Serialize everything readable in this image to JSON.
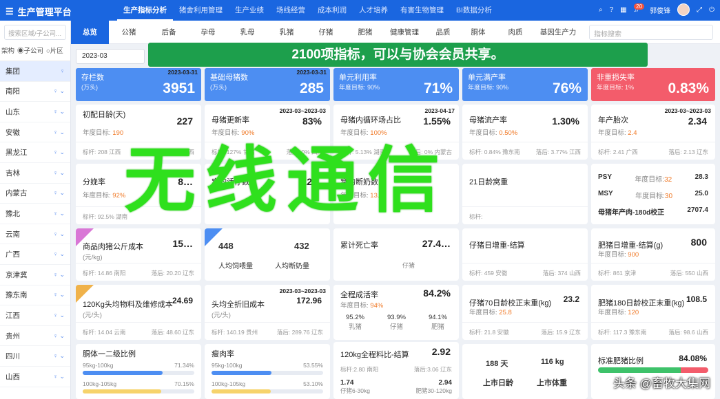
{
  "app": {
    "title": "生产管理平台",
    "icon": "stack-icon"
  },
  "nav": [
    "生产指标分析",
    "猪舍利用管理",
    "生产业绩",
    "场线经营",
    "成本利润",
    "人才培养",
    "有害生物管理",
    "BI数据分析"
  ],
  "user": {
    "notif_count": "20",
    "name": "郭俊锋"
  },
  "sidebar": {
    "search_placeholder": "搜索区域/子公司...",
    "arch_label": "架构",
    "opt1": "子公司",
    "opt2": "片区",
    "items": [
      "集团",
      "南阳",
      "山东",
      "安徽",
      "黑龙江",
      "吉林",
      "内蒙古",
      "豫北",
      "云南",
      "广西",
      "京津冀",
      "豫东南",
      "江西",
      "贵州",
      "四川",
      "山西"
    ]
  },
  "tabs": [
    "总览",
    "公猪",
    "后备",
    "孕母",
    "乳母",
    "乳猪",
    "仔猪",
    "肥猪",
    "健康管理",
    "品质",
    "胴体",
    "肉质",
    "基因生产力"
  ],
  "tab_search_placeholder": "指标搜索",
  "date": "2023-03",
  "banner": "2100项指标，可以与协会会员共享。",
  "overlay": "无线通信",
  "watermark": "头条 @畜牧大集网",
  "kpis": [
    {
      "name": "存栏数",
      "sub": "(万头)",
      "value": "3951",
      "date": "2023-03-31",
      "color": "#4d8ef2"
    },
    {
      "name": "基础母猪数",
      "sub": "(万头)",
      "value": "285",
      "date": "2023-03-31",
      "color": "#4d8ef2"
    },
    {
      "name": "单元利用率",
      "sub": "年度目标: 90%",
      "value": "71%",
      "date": "",
      "color": "#4d8ef2"
    },
    {
      "name": "单元满产率",
      "sub": "年度目标: 90%",
      "value": "76%",
      "date": "",
      "color": "#4d8ef2"
    },
    {
      "name": "非重损失率",
      "sub": "年度目标: 1%",
      "value": "0.83%",
      "date": "",
      "color": "#f35c6b"
    }
  ],
  "row1": [
    {
      "title": "初配日龄(天)",
      "value": "227",
      "date": "",
      "target_label": "年度目标:",
      "target": "190",
      "f1": "标杆: 208 江西",
      "f2": "落后: 247 山西"
    },
    {
      "title": "母猪更新率",
      "value": "83%",
      "date": "2023-03~2023-03",
      "target_label": "年度目标:",
      "target": "90%",
      "f1": "标杆: 127% 甘肃",
      "f2": "落后: 0% 四川"
    },
    {
      "title": "母猪内循环场占比",
      "value": "1.55%",
      "date": "2023-04-17",
      "target_label": "年度目标:",
      "target": "100%",
      "f1": "标杆: 5.13% 湖南",
      "f2": "落后: 0% 内蒙古"
    },
    {
      "title": "母猪流产率",
      "value": "1.30%",
      "date": "",
      "target_label": "年度目标:",
      "target": "0.50%",
      "f1": "标杆: 0.84% 豫东南",
      "f2": "落后: 3.77% 江西"
    },
    {
      "title": "年产胎次",
      "value": "2.34",
      "date": "2023-03~2023-03",
      "target_label": "年度目标:",
      "target": "2.4",
      "f1": "标杆: 2.41 广西",
      "f2": "落后: 2.13 辽东"
    }
  ],
  "row2": [
    {
      "title": "分娩率",
      "value": "8…",
      "target_label": "年度目标:",
      "target": "92%",
      "f1": "标杆: 92.5% 湖南",
      "f2": ""
    },
    {
      "title": "窝均活仔数",
      "value": "12…",
      "target_label": "",
      "target": "",
      "f1": "",
      "f2": ""
    },
    {
      "title": "窝均断奶数",
      "value": "",
      "target_label": "年度目标:",
      "target": "13.2",
      "f1": "",
      "f2": ""
    },
    {
      "title": "21日龄窝重",
      "value": "",
      "target_label": "",
      "target": "",
      "f1": "标杆:",
      "f2": ""
    }
  ],
  "psy": {
    "r1": [
      "PSY",
      "年度目标:",
      "32",
      "28.3"
    ],
    "r2": [
      "MSY",
      "年度目标:",
      "30",
      "25.0"
    ],
    "r3": [
      "母猪年产肉-180d校正",
      "2707.4"
    ]
  },
  "row3": [
    {
      "title": "商品肉猪公斤成本",
      "sub": "(元/kg)",
      "value": "15…",
      "f1": "标杆: 14.86 南阳",
      "f2": "落后: 20.20 辽东"
    },
    {
      "title": "人均饲喂量",
      "value": "448",
      "f1": "",
      "f2": ""
    },
    {
      "title": "人均断奶量",
      "value": "432",
      "f1": "",
      "f2": ""
    },
    {
      "title": "累计死亡率",
      "value": "27.4…",
      "f1": "仔猪",
      "f2": ""
    },
    {
      "title": "仔猪日增重-结算",
      "value": "",
      "f1": "标杆: 459 安徽",
      "f2": "落后: 374 山西"
    },
    {
      "title": "肥猪日增重-结算(g)",
      "value": "800",
      "target_label": "年度目标:",
      "target": "900",
      "f1": "标杆: 861 京津",
      "f2": "落后: 550 山西"
    }
  ],
  "row4": [
    {
      "title": "120Kg头均物料及维修成本",
      "sub": "(元/头)",
      "value": "24.69",
      "f1": "标杆: 14.04 云南",
      "f2": "落后: 48.60 辽东"
    },
    {
      "title": "头均全折旧成本",
      "sub": "(元/头)",
      "value": "172.96",
      "date": "2023-03~2023-03",
      "f1": "标杆: 140.19 贵州",
      "f2": "落后: 289.76 辽东"
    },
    {
      "title": "全程成活率",
      "value": "84.2%",
      "target_label": "年度目标:",
      "target": "94%",
      "s": [
        [
          "95.2%",
          "乳猪"
        ],
        [
          "93.9%",
          "仔猪"
        ],
        [
          "94.1%",
          "肥猪"
        ]
      ]
    },
    {
      "title": "仔猪70日龄校正末重(kg)",
      "value": "23.2",
      "target_label": "年度目标:",
      "target": "25.8",
      "f1": "标杆: 21.8 安徽",
      "f2": "落后: 15.9 辽东"
    },
    {
      "title": "肥猪180日龄校正末重(kg)",
      "value": "108.5",
      "target_label": "年度目标:",
      "target": "120",
      "f1": "标杆: 117.3 豫东南",
      "f2": "落后: 98.6 山西"
    }
  ],
  "row5": {
    "ratio": {
      "title": "胴体一二级比例",
      "a": "95kg-100kg",
      "ap": "71.34%",
      "afill": 0.7134,
      "b": "100kg-105kg",
      "bp": "70.15%",
      "bfill": 0.7015
    },
    "lean": {
      "title": "瘦肉率",
      "a": "95kg-100kg",
      "ap": "53.55%",
      "afill": 0.5355,
      "b": "100kg-105kg",
      "bp": "53.10%",
      "bfill": 0.531
    },
    "fcr": {
      "title": "120kg全程料比-结算",
      "value": "2.92",
      "f1": "标杆:2.80 南阳",
      "f2": "落后:3.06 辽东",
      "a": "1.74",
      "al": "仔猪6-30kg",
      "b": "2.94",
      "bl": "肥猪30-120kg"
    },
    "market": {
      "a": "188 天",
      "b": "116 kg",
      "al": "上市日龄",
      "bl": "上市体重"
    },
    "std": {
      "title": "标准肥猪比例",
      "value": "84.08%"
    }
  },
  "colors": {
    "brand": "#1a66e0",
    "banner": "#1d9f4c",
    "overlay": "#2fe01d",
    "target": "#f07a28"
  }
}
